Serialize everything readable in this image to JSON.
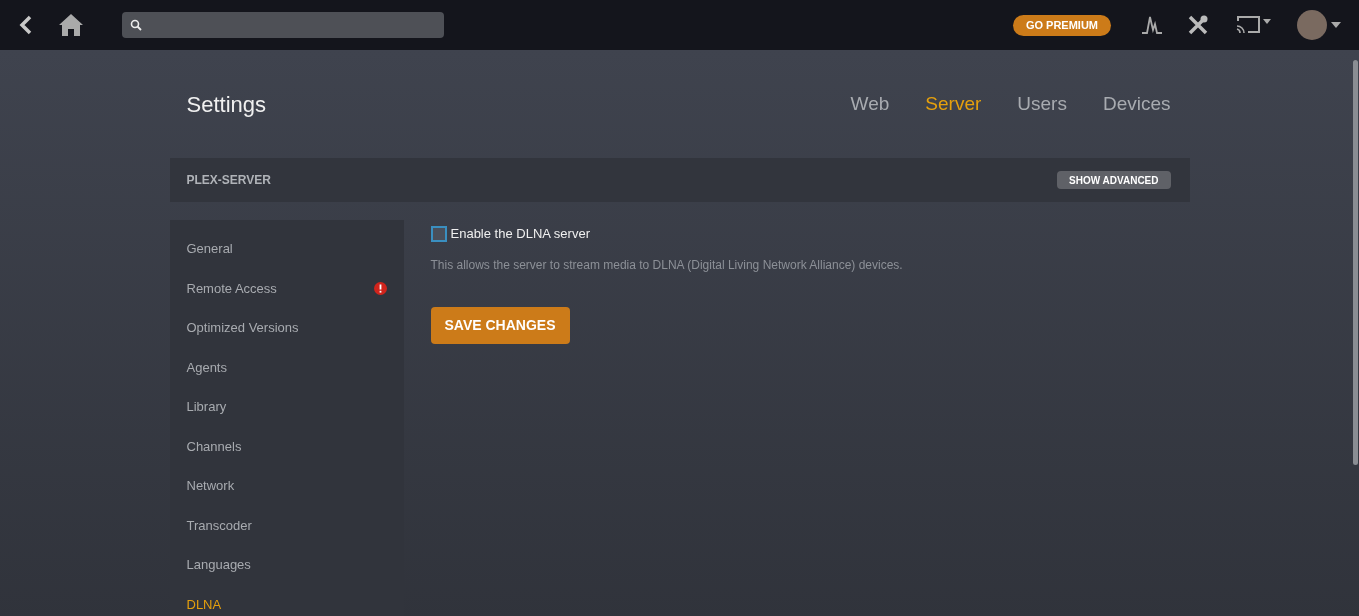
{
  "topbar": {
    "premium_button": "GO PREMIUM"
  },
  "page": {
    "title": "Settings",
    "tabs": [
      {
        "label": "Web",
        "selected": false
      },
      {
        "label": "Server",
        "selected": true
      },
      {
        "label": "Users",
        "selected": false
      },
      {
        "label": "Devices",
        "selected": false
      }
    ]
  },
  "server_bar": {
    "name": "PLEX-SERVER",
    "advanced_button": "SHOW ADVANCED"
  },
  "sidebar": {
    "items": [
      {
        "label": "General",
        "selected": false,
        "alert": false
      },
      {
        "label": "Remote Access",
        "selected": false,
        "alert": true
      },
      {
        "label": "Optimized Versions",
        "selected": false,
        "alert": false
      },
      {
        "label": "Agents",
        "selected": false,
        "alert": false
      },
      {
        "label": "Library",
        "selected": false,
        "alert": false
      },
      {
        "label": "Channels",
        "selected": false,
        "alert": false
      },
      {
        "label": "Network",
        "selected": false,
        "alert": false
      },
      {
        "label": "Transcoder",
        "selected": false,
        "alert": false
      },
      {
        "label": "Languages",
        "selected": false,
        "alert": false
      },
      {
        "label": "DLNA",
        "selected": true,
        "alert": false
      }
    ]
  },
  "settings": {
    "option": {
      "label": "Enable the DLNA server",
      "checked": false,
      "description": "This allows the server to stream media to DLNA (Digital Living Network Alliance) devices."
    },
    "save_button": "SAVE CHANGES"
  }
}
